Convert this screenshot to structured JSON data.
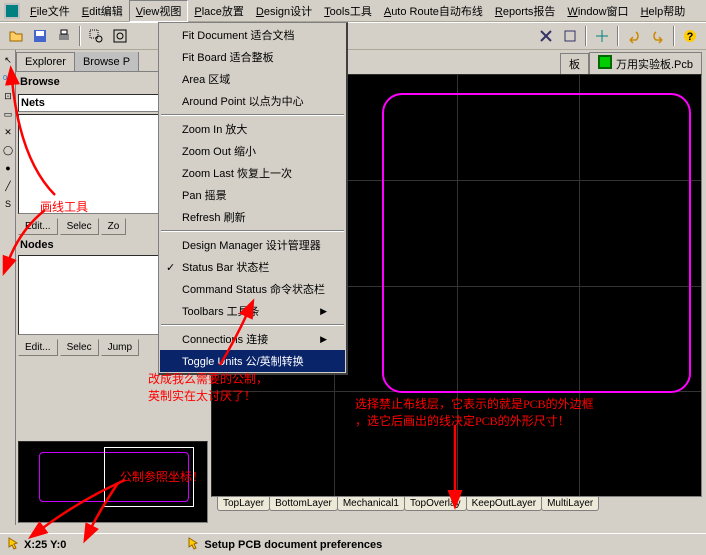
{
  "menubar": {
    "items": [
      {
        "u": "F",
        "label": "ile文件"
      },
      {
        "u": "E",
        "label": "dit编辑"
      },
      {
        "u": "V",
        "label": "iew视图"
      },
      {
        "u": "P",
        "label": "lace放置"
      },
      {
        "u": "D",
        "label": "esign设计"
      },
      {
        "u": "T",
        "label": "ools工具"
      },
      {
        "u": "A",
        "label": "uto Route自动布线"
      },
      {
        "u": "R",
        "label": "eports报告"
      },
      {
        "u": "W",
        "label": "indow窗口"
      },
      {
        "u": "H",
        "label": "elp帮助"
      }
    ]
  },
  "dropdown": {
    "groups": [
      [
        "Fit Document 适合文档",
        "Fit Board 适合整板",
        "Area 区域",
        "Around Point 以点为中心"
      ],
      [
        "Zoom In 放大",
        "Zoom Out 缩小",
        "Zoom Last 恢复上一次",
        "Pan 摇景",
        "Refresh 刷新"
      ],
      [
        "Design Manager 设计管理器",
        "Status Bar 状态栏",
        "Command Status 命令状态栏"
      ]
    ],
    "toolbars": "Toolbars 工具条",
    "connections": "Connections 连接",
    "toggle": "Toggle Units 公/英制转换",
    "checked_index": 1
  },
  "explorer": {
    "tabs": [
      "Explorer",
      "Browse P"
    ],
    "browse_label": "Browse",
    "nets_label": "Nets",
    "nodes_label": "Nodes",
    "buttons1": [
      "Edit...",
      "Selec",
      "Zo"
    ],
    "buttons2": [
      "Edit...",
      "Selec",
      "Jump"
    ]
  },
  "doctabs": {
    "tab1": "板",
    "tab2": "万用实验板.Pcb"
  },
  "layers": [
    "TopLayer",
    "BottomLayer",
    "Mechanical1",
    "TopOverlay",
    "KeepOutLayer",
    "MultiLayer"
  ],
  "status": {
    "coords": "X:25 Y:0",
    "hint": "Setup PCB document preferences"
  },
  "annotations": {
    "tool": "画线工具",
    "units": "改成我么需要的公制，\n英制实在太讨厌了！",
    "keepout": "选择禁止布线层，它表示的就是PCB的外边框\n，选它后画出的线决定PCB的外形尺寸！",
    "origin": "公制参照坐标！"
  }
}
